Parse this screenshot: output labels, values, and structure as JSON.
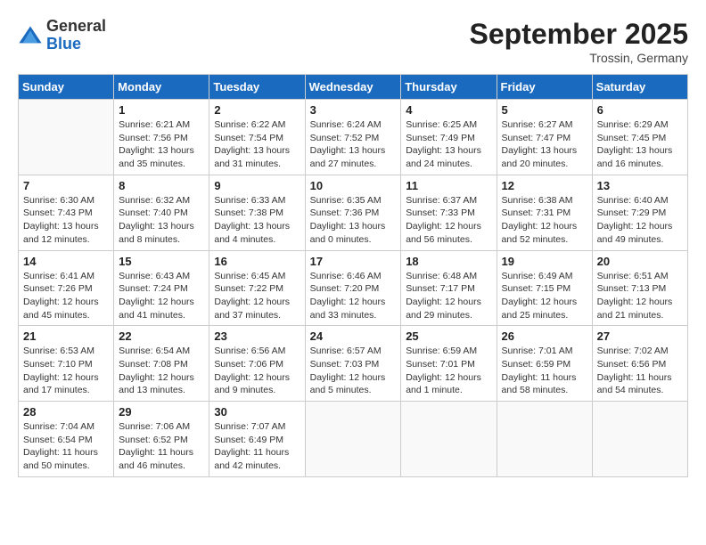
{
  "header": {
    "logo_general": "General",
    "logo_blue": "Blue",
    "month_title": "September 2025",
    "location": "Trossin, Germany"
  },
  "days_of_week": [
    "Sunday",
    "Monday",
    "Tuesday",
    "Wednesday",
    "Thursday",
    "Friday",
    "Saturday"
  ],
  "weeks": [
    [
      {
        "day": "",
        "info": ""
      },
      {
        "day": "1",
        "info": "Sunrise: 6:21 AM\nSunset: 7:56 PM\nDaylight: 13 hours\nand 35 minutes."
      },
      {
        "day": "2",
        "info": "Sunrise: 6:22 AM\nSunset: 7:54 PM\nDaylight: 13 hours\nand 31 minutes."
      },
      {
        "day": "3",
        "info": "Sunrise: 6:24 AM\nSunset: 7:52 PM\nDaylight: 13 hours\nand 27 minutes."
      },
      {
        "day": "4",
        "info": "Sunrise: 6:25 AM\nSunset: 7:49 PM\nDaylight: 13 hours\nand 24 minutes."
      },
      {
        "day": "5",
        "info": "Sunrise: 6:27 AM\nSunset: 7:47 PM\nDaylight: 13 hours\nand 20 minutes."
      },
      {
        "day": "6",
        "info": "Sunrise: 6:29 AM\nSunset: 7:45 PM\nDaylight: 13 hours\nand 16 minutes."
      }
    ],
    [
      {
        "day": "7",
        "info": "Sunrise: 6:30 AM\nSunset: 7:43 PM\nDaylight: 13 hours\nand 12 minutes."
      },
      {
        "day": "8",
        "info": "Sunrise: 6:32 AM\nSunset: 7:40 PM\nDaylight: 13 hours\nand 8 minutes."
      },
      {
        "day": "9",
        "info": "Sunrise: 6:33 AM\nSunset: 7:38 PM\nDaylight: 13 hours\nand 4 minutes."
      },
      {
        "day": "10",
        "info": "Sunrise: 6:35 AM\nSunset: 7:36 PM\nDaylight: 13 hours\nand 0 minutes."
      },
      {
        "day": "11",
        "info": "Sunrise: 6:37 AM\nSunset: 7:33 PM\nDaylight: 12 hours\nand 56 minutes."
      },
      {
        "day": "12",
        "info": "Sunrise: 6:38 AM\nSunset: 7:31 PM\nDaylight: 12 hours\nand 52 minutes."
      },
      {
        "day": "13",
        "info": "Sunrise: 6:40 AM\nSunset: 7:29 PM\nDaylight: 12 hours\nand 49 minutes."
      }
    ],
    [
      {
        "day": "14",
        "info": "Sunrise: 6:41 AM\nSunset: 7:26 PM\nDaylight: 12 hours\nand 45 minutes."
      },
      {
        "day": "15",
        "info": "Sunrise: 6:43 AM\nSunset: 7:24 PM\nDaylight: 12 hours\nand 41 minutes."
      },
      {
        "day": "16",
        "info": "Sunrise: 6:45 AM\nSunset: 7:22 PM\nDaylight: 12 hours\nand 37 minutes."
      },
      {
        "day": "17",
        "info": "Sunrise: 6:46 AM\nSunset: 7:20 PM\nDaylight: 12 hours\nand 33 minutes."
      },
      {
        "day": "18",
        "info": "Sunrise: 6:48 AM\nSunset: 7:17 PM\nDaylight: 12 hours\nand 29 minutes."
      },
      {
        "day": "19",
        "info": "Sunrise: 6:49 AM\nSunset: 7:15 PM\nDaylight: 12 hours\nand 25 minutes."
      },
      {
        "day": "20",
        "info": "Sunrise: 6:51 AM\nSunset: 7:13 PM\nDaylight: 12 hours\nand 21 minutes."
      }
    ],
    [
      {
        "day": "21",
        "info": "Sunrise: 6:53 AM\nSunset: 7:10 PM\nDaylight: 12 hours\nand 17 minutes."
      },
      {
        "day": "22",
        "info": "Sunrise: 6:54 AM\nSunset: 7:08 PM\nDaylight: 12 hours\nand 13 minutes."
      },
      {
        "day": "23",
        "info": "Sunrise: 6:56 AM\nSunset: 7:06 PM\nDaylight: 12 hours\nand 9 minutes."
      },
      {
        "day": "24",
        "info": "Sunrise: 6:57 AM\nSunset: 7:03 PM\nDaylight: 12 hours\nand 5 minutes."
      },
      {
        "day": "25",
        "info": "Sunrise: 6:59 AM\nSunset: 7:01 PM\nDaylight: 12 hours\nand 1 minute."
      },
      {
        "day": "26",
        "info": "Sunrise: 7:01 AM\nSunset: 6:59 PM\nDaylight: 11 hours\nand 58 minutes."
      },
      {
        "day": "27",
        "info": "Sunrise: 7:02 AM\nSunset: 6:56 PM\nDaylight: 11 hours\nand 54 minutes."
      }
    ],
    [
      {
        "day": "28",
        "info": "Sunrise: 7:04 AM\nSunset: 6:54 PM\nDaylight: 11 hours\nand 50 minutes."
      },
      {
        "day": "29",
        "info": "Sunrise: 7:06 AM\nSunset: 6:52 PM\nDaylight: 11 hours\nand 46 minutes."
      },
      {
        "day": "30",
        "info": "Sunrise: 7:07 AM\nSunset: 6:49 PM\nDaylight: 11 hours\nand 42 minutes."
      },
      {
        "day": "",
        "info": ""
      },
      {
        "day": "",
        "info": ""
      },
      {
        "day": "",
        "info": ""
      },
      {
        "day": "",
        "info": ""
      }
    ]
  ]
}
